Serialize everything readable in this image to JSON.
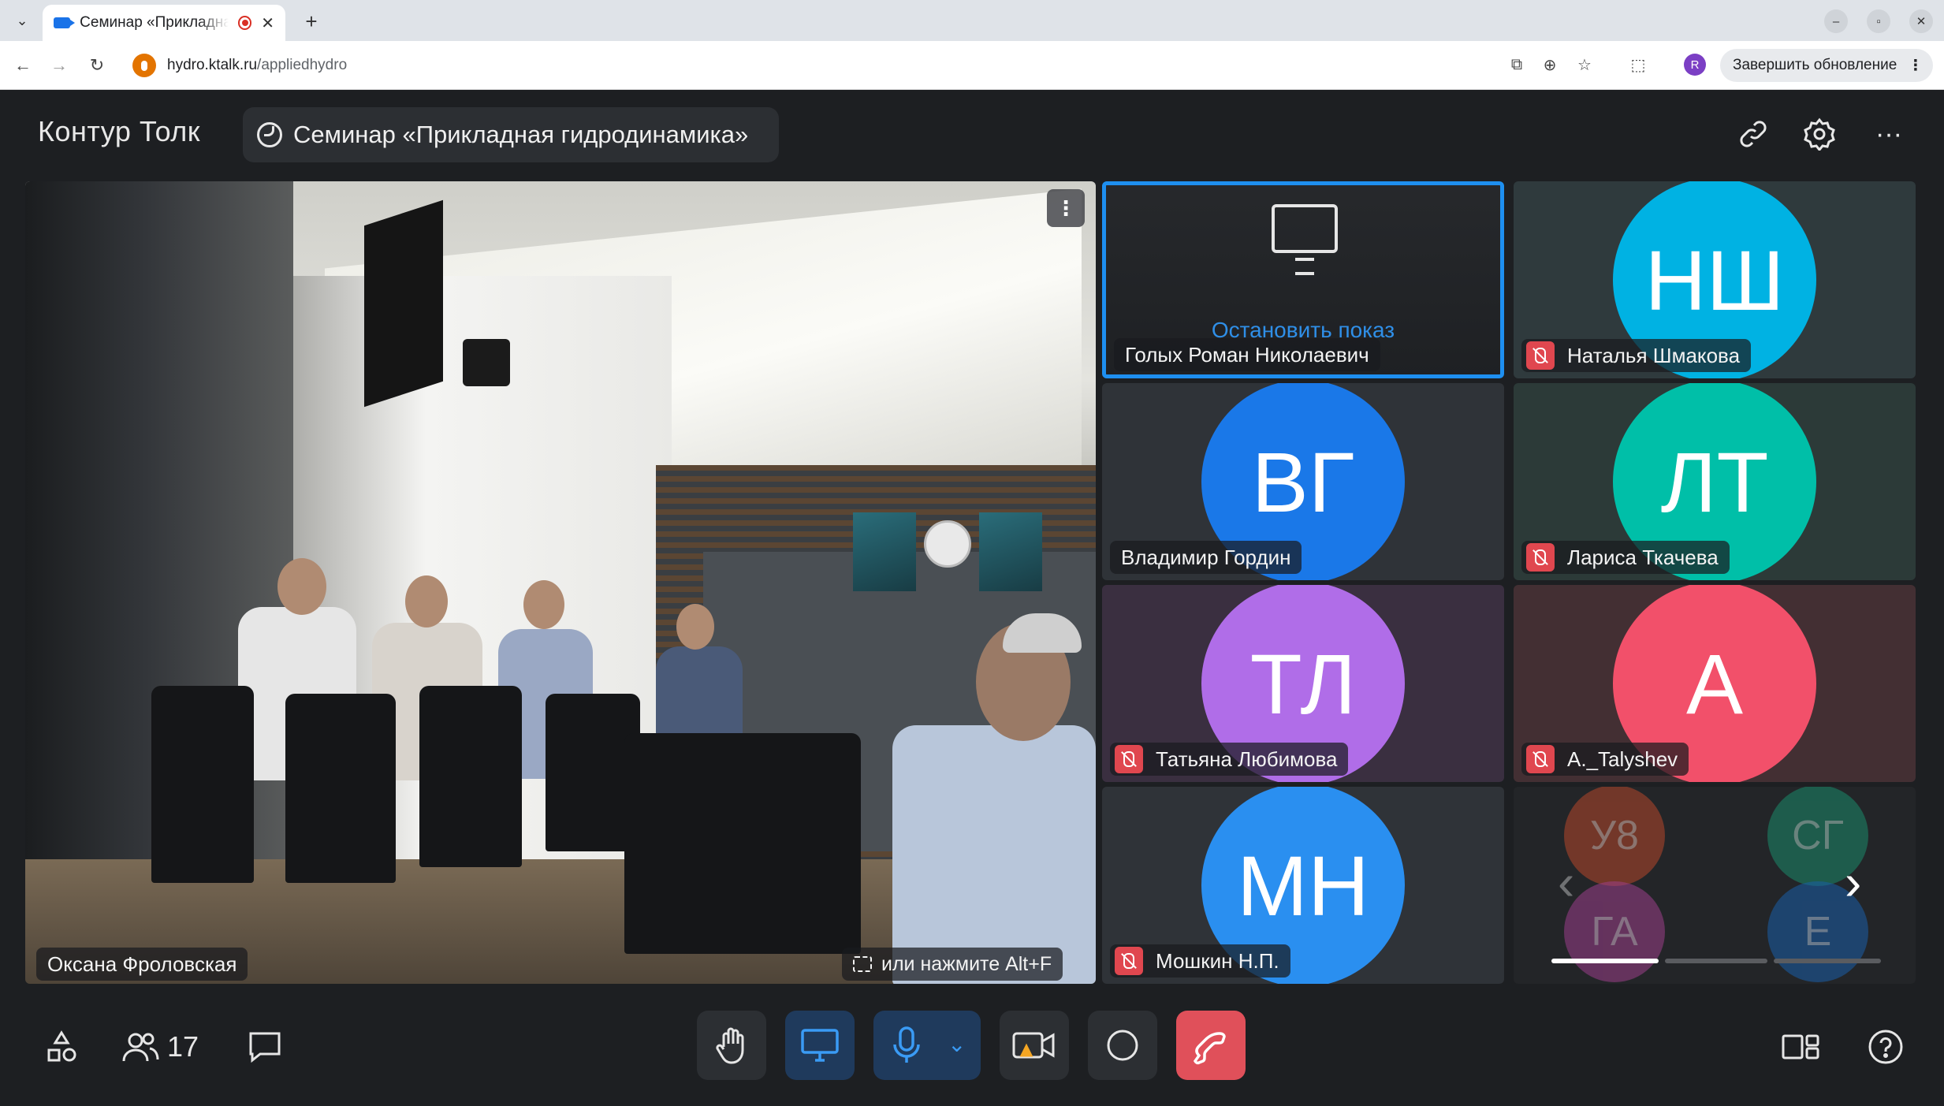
{
  "browser": {
    "tab_title": "Семинар «Прикладная гидродинамика»",
    "url_host": "hydro.ktalk.ru",
    "url_path": "/appliedhydro",
    "profile_initial": "R",
    "update_button": "Завершить обновление"
  },
  "app": {
    "brand": "Контур Толк",
    "meeting_title": "Семинар «Прикладная гидродинамика»"
  },
  "main_video": {
    "participant": "Оксана Фроловская",
    "fullscreen_hint": "или нажмите Alt+F"
  },
  "screen_share_tile": {
    "participant": "Голых Роман Николаевич",
    "stop_label": "Остановить показ"
  },
  "tiles": [
    {
      "initials": "НШ",
      "name": "Наталья Шмакова",
      "color": "#00b2e3",
      "bg": "#2f3a3d",
      "muted": true
    },
    {
      "initials": "ВГ",
      "name": "Владимир Гордин",
      "color": "#1a78e8",
      "bg": "#2f3338",
      "muted": false
    },
    {
      "initials": "ЛТ",
      "name": "Лариса Ткачева",
      "color": "#00bfa8",
      "bg": "#2c3a38",
      "muted": true
    },
    {
      "initials": "ТЛ",
      "name": "Татьяна Любимова",
      "color": "#b06de8",
      "bg": "#3a2f40",
      "muted": true
    },
    {
      "initials": "А",
      "name": "А._Talyshev",
      "color": "#f2506a",
      "bg": "#432f33",
      "muted": true
    },
    {
      "initials": "МН",
      "name": "Мошкин Н.П.",
      "color": "#2a8ff0",
      "bg": "#2f3338",
      "muted": true
    }
  ],
  "overflow_tile": {
    "avatars": [
      {
        "initials": "У8",
        "color": "#b5472a"
      },
      {
        "initials": "СГ",
        "color": "#1a8a6a"
      },
      {
        "initials": "ГА",
        "color": "#9c3f8a"
      },
      {
        "initials": "Е",
        "color": "#1a5fa8"
      }
    ]
  },
  "toolbar": {
    "participants_count": "17"
  },
  "colors": {
    "app_bg": "#1d1f22",
    "accent": "#1e8ff0",
    "end_call": "#e0505a",
    "muted_badge": "#e0474f"
  }
}
